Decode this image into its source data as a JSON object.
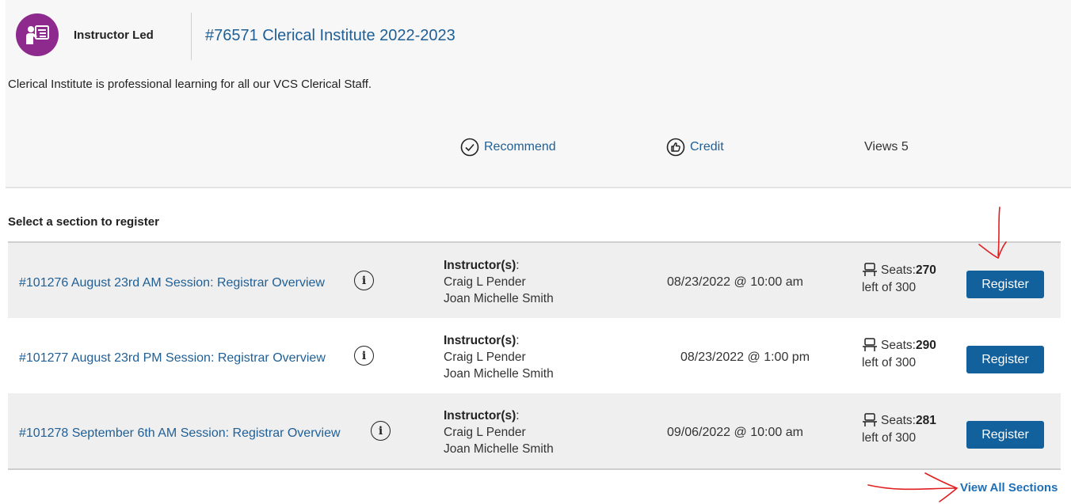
{
  "course": {
    "type_label": "Instructor Led",
    "title": "#76571 Clerical Institute 2022-2023",
    "description": "Clerical Institute is professional learning for all our VCS Clerical Staff.",
    "actions": {
      "recommend_label": "Recommend",
      "credit_label": "Credit",
      "views_label": "Views 5"
    },
    "icons": {
      "type": "instructor-led-icon",
      "recommend": "check-circle-icon",
      "credit": "thumbs-up-icon"
    },
    "colors": {
      "type_icon_bg": "#8e2a8e",
      "link": "#1f5f96",
      "button": "#12609c",
      "annotation": "#e02020"
    }
  },
  "sections": {
    "heading": "Select a section to register",
    "instructors_header": "Instructor(s)",
    "instructors_colon": ":",
    "rows": [
      {
        "title": "#101276 August 23rd AM Session: Registrar Overview",
        "instructors": [
          "Craig L Pender",
          "Joan Michelle Smith"
        ],
        "datetime": "08/23/2022 @ 10:00 am",
        "seats_label": "Seats:",
        "seats_count": "270",
        "seats_total": "left of 300",
        "register_label": "Register"
      },
      {
        "title": "#101277 August 23rd PM Session: Registrar Overview",
        "instructors": [
          "Craig L Pender",
          "Joan Michelle Smith"
        ],
        "datetime": "08/23/2022 @ 1:00 pm",
        "seats_label": "Seats:",
        "seats_count": "290",
        "seats_total": "left of 300",
        "register_label": "Register"
      },
      {
        "title": "#101278 September 6th AM Session: Registrar Overview",
        "instructors": [
          "Craig L Pender",
          "Joan Michelle Smith"
        ],
        "datetime": "09/06/2022 @ 10:00 am",
        "seats_label": "Seats:",
        "seats_count": "281",
        "seats_total": "left of 300",
        "register_label": "Register"
      }
    ],
    "view_all_label": "View All Sections"
  }
}
